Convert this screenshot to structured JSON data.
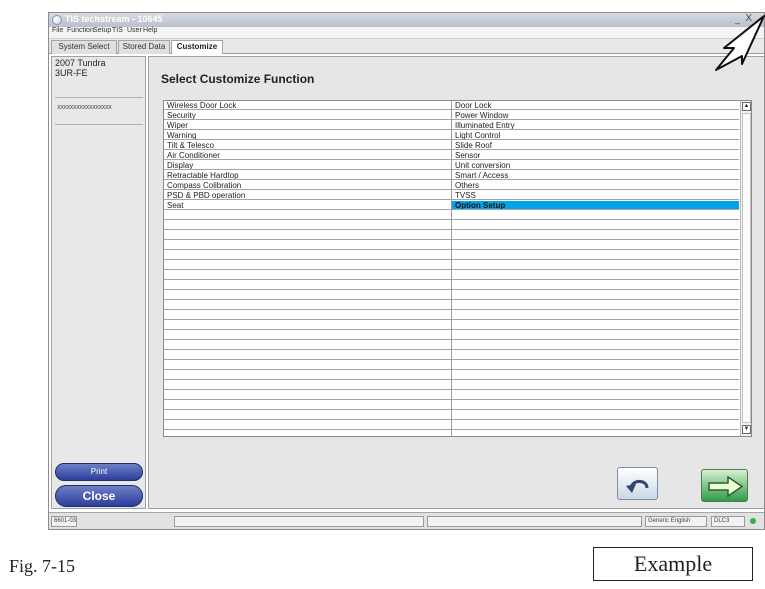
{
  "window": {
    "title": "TIS techstream - 10645",
    "minimize_glyph": "_",
    "close_glyph": "X"
  },
  "menu": [
    "File",
    "Function",
    "Setup",
    "TIS",
    "User",
    "Help"
  ],
  "tabs": [
    {
      "label": "System Select",
      "active": false
    },
    {
      "label": "Stored Data",
      "active": false
    },
    {
      "label": "Customize",
      "active": true
    }
  ],
  "sidebar": {
    "vehicle_model": "2007 Tundra",
    "vehicle_engine": "3UR-FE",
    "vin": "xxxxxxxxxxxxxxxxx",
    "print_label": "Print",
    "close_label": "Close"
  },
  "main": {
    "title": "Select Customize Function",
    "left_column": [
      "Wireless Door Lock",
      "Security",
      "Wiper",
      "Warning",
      "Tilt & Telesco",
      "Air Conditioner",
      "Display",
      "Retractable Hardtop",
      "Compass Colibration",
      "PSD & PBD operation",
      "Seat"
    ],
    "right_column": [
      "Door Lock",
      "Power Window",
      "Illuminated Entry",
      "Light Control",
      "Slide Roof",
      "Sensor",
      "Unit conversion",
      "Smart / Access",
      "Others",
      "TVSS",
      "Option Setup"
    ],
    "selected": "Option Setup",
    "scroll_up_glyph": "▲",
    "scroll_down_glyph": "▼",
    "back_icon": "undo-arrow-icon",
    "next_icon": "right-arrow-icon"
  },
  "statusbar": {
    "code": "6601-03",
    "language": "Generic English",
    "connection": "DLC3",
    "connection_color": "#36b04a"
  },
  "caption": "Fig. 7-15",
  "example_label": "Example",
  "colors": {
    "selected_row": "#00a3e6",
    "button_blue": "#2c3e9c",
    "next_green": "#2e9a4a"
  }
}
